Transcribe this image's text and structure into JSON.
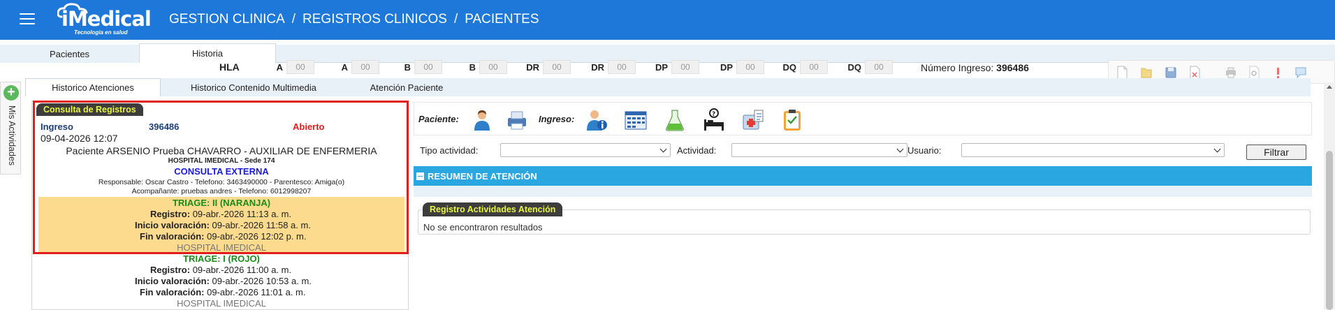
{
  "header": {
    "logo_text": "iMedical",
    "logo_tagline": "Tecnología en salud",
    "breadcrumb": [
      "GESTION CLINICA",
      "REGISTROS CLINICOS",
      "PACIENTES"
    ],
    "separator": "/",
    "bg_color": "#1d78d9"
  },
  "main_tabs": [
    {
      "label": "Pacientes",
      "active": false
    },
    {
      "label": "Historia",
      "active": true
    }
  ],
  "hla": {
    "title": "HLA",
    "fields": [
      {
        "label": "A",
        "value": "00"
      },
      {
        "label": "A",
        "value": "00"
      },
      {
        "label": "B",
        "value": "00"
      },
      {
        "label": "B",
        "value": "00"
      },
      {
        "label": "DR",
        "value": "00"
      },
      {
        "label": "DR",
        "value": "00"
      },
      {
        "label": "DP",
        "value": "00"
      },
      {
        "label": "DP",
        "value": "00"
      },
      {
        "label": "DQ",
        "value": "00"
      },
      {
        "label": "DQ",
        "value": "00"
      }
    ],
    "ingreso_label": "Número Ingreso:",
    "ingreso_value": "396486"
  },
  "side": {
    "mis_actividades": "Mis Actividades",
    "plus": "+"
  },
  "sub_tabs": [
    {
      "label": "Historico Atenciones",
      "active": true
    },
    {
      "label": "Historico Contenido Multimedia",
      "active": false
    },
    {
      "label": "Atención Paciente",
      "active": false
    }
  ],
  "consulta": {
    "header": "Consulta de Registros",
    "record": {
      "ingreso_label": "Ingreso",
      "ingreso_number": "396486",
      "status": "Abierto",
      "datetime": "09-04-2026 12:07",
      "patient_line": "Paciente ARSENIO Prueba CHAVARRO - AUXILIAR DE ENFERMERIA",
      "hospital_sede": "HOSPITAL IMEDICAL - Sede 174",
      "service": "CONSULTA EXTERNA",
      "responsable": "Responsable: Oscar Castro - Telefono: 3463490000 - Parentesco: Amiga(o)",
      "acompanante": "Acompañante: pruebas andres - Telefono: 6012998207"
    },
    "triages": [
      {
        "title": "TRIAGE: II (NARANJA)",
        "registro_label": "Registro:",
        "registro": "09-abr.-2026 11:13 a. m.",
        "inicio_label": "Inicio valoración:",
        "inicio": "09-abr.-2026 11:58 a. m.",
        "fin_label": "Fin valoración:",
        "fin": "09-abr.-2026 12:02 p. m.",
        "hospital": "HOSPITAL IMEDICAL",
        "highlight_color": "#fcdb8f"
      },
      {
        "title": "TRIAGE: I (ROJO)",
        "registro_label": "Registro:",
        "registro": "09-abr.-2026 11:00 a. m.",
        "inicio_label": "Inicio valoración:",
        "inicio": "09-abr.-2026 10:53 a. m.",
        "fin_label": "Fin valoración:",
        "fin": "09-abr.-2026 11:01 a. m.",
        "hospital": "HOSPITAL IMEDICAL"
      }
    ]
  },
  "iconbar": {
    "paciente_label": "Paciente:",
    "ingreso_label": "Ingreso:",
    "paciente_icons": [
      "patient-user-icon",
      "printer-icon"
    ],
    "ingreso_icons": [
      "patient-info-icon",
      "calendar-grid-icon",
      "lab-flask-icon",
      "bed-question-icon",
      "medical-kit-icon",
      "checklist-clipboard-icon"
    ]
  },
  "filters": {
    "tipo_actividad_label": "Tipo actividad:",
    "actividad_label": "Actividad:",
    "usuario_label": "Usuario:",
    "tipo_actividad_value": "",
    "actividad_value": "",
    "usuario_value": "",
    "filtrar_label": "Filtrar"
  },
  "resumen": {
    "title": "RESUMEN DE ATENCIÓN",
    "bar_color": "#2aa6e0"
  },
  "registro_actividades": {
    "header": "Registro Actividades Atención",
    "empty_message": "No se encontraron resultados"
  },
  "toolbar_icons": [
    "new-document-icon",
    "open-folder-icon",
    "save-icon",
    "delete-icon",
    "print-icon",
    "preview-icon",
    "alert-icon",
    "comment-icon"
  ]
}
